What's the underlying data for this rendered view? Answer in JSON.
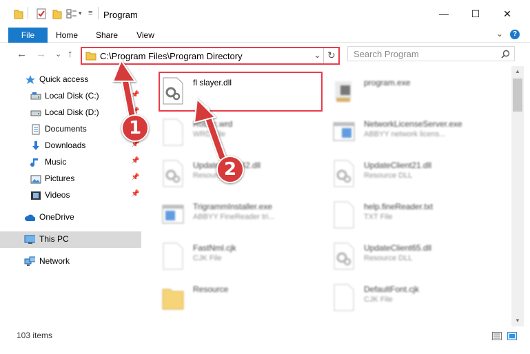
{
  "window": {
    "title": "Program",
    "minimize_glyph": "—",
    "maximize_glyph": "☐",
    "close_glyph": "✕"
  },
  "ribbon": {
    "tabs": [
      {
        "label": "File"
      },
      {
        "label": "Home"
      },
      {
        "label": "Share"
      },
      {
        "label": "View"
      }
    ],
    "help_glyph": "?",
    "expand_glyph": "⌄"
  },
  "address": {
    "path": "C:\\Program Files\\Program Directory",
    "back_glyph": "←",
    "forward_glyph": "→",
    "recent_glyph": "⌄",
    "up_glyph": "↑",
    "dropdown_glyph": "⌄",
    "refresh_glyph": "↻"
  },
  "search": {
    "placeholder": "Search Program",
    "icon": "search-icon"
  },
  "nav": {
    "items": [
      {
        "label": "Quick access",
        "icon": "star-icon"
      },
      {
        "label": "Local Disk (C:)",
        "icon": "drive-icon",
        "pinned": true
      },
      {
        "label": "Local Disk (D:)",
        "icon": "drive-icon",
        "pinned": true
      },
      {
        "label": "Documents",
        "icon": "documents-icon",
        "pinned": true
      },
      {
        "label": "Downloads",
        "icon": "download-icon",
        "pinned": true
      },
      {
        "label": "Music",
        "icon": "music-icon",
        "pinned": true
      },
      {
        "label": "Pictures",
        "icon": "pictures-icon",
        "pinned": true
      },
      {
        "label": "Videos",
        "icon": "videos-icon",
        "pinned": true
      },
      {
        "label": "OneDrive",
        "icon": "cloud-icon"
      },
      {
        "label": "This PC",
        "icon": "computer-icon",
        "selected": true
      },
      {
        "label": "Network",
        "icon": "network-icon"
      }
    ],
    "pin_glyph": "📌"
  },
  "files": [
    {
      "name": "fl slayer.dll",
      "type": "",
      "icon": "dll-file-icon",
      "highlighted": true
    },
    {
      "name": "program.exe",
      "type": "",
      "icon": "exe-file-icon"
    },
    {
      "name": "Roboc.wrd",
      "type": "WRD File",
      "icon": "blank-file-icon"
    },
    {
      "name": "NetworkLicenseServer.exe",
      "type": "ABBYY network licens...",
      "icon": "exe-window-icon"
    },
    {
      "name": "UpdateClient42.dll",
      "type": "Resource DLL",
      "icon": "dll-file-icon"
    },
    {
      "name": "UpdateClient21.dll",
      "type": "Resource DLL",
      "icon": "dll-file-icon"
    },
    {
      "name": "TrigrammInstaller.exe",
      "type": "ABBYY FineReader tri...",
      "icon": "exe-window-icon"
    },
    {
      "name": "help.fineReader.txt",
      "type": "TXT File",
      "icon": "blank-file-icon"
    },
    {
      "name": "FastNml.cjk",
      "type": "CJK File",
      "icon": "blank-file-icon"
    },
    {
      "name": "UpdateClient65.dll",
      "type": "Resource DLL",
      "icon": "dll-file-icon"
    },
    {
      "name": "Resource",
      "type": "",
      "icon": "folder-icon"
    },
    {
      "name": "DefaultFont.cjk",
      "type": "CJK File",
      "icon": "blank-file-icon"
    }
  ],
  "status": {
    "item_count": "103 items"
  },
  "callouts": [
    {
      "label": "1"
    },
    {
      "label": "2"
    }
  ],
  "colors": {
    "accent": "#1979ca",
    "highlight_red": "#e83c4a",
    "callout_red": "#d63a3a",
    "selected_bg": "#d9d9d9"
  }
}
